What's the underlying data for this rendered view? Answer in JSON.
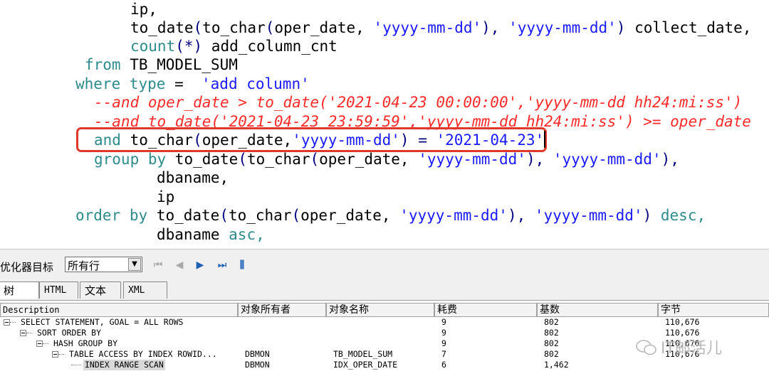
{
  "editor": {
    "lines": [
      [
        {
          "t": "ip,",
          "c": "tx"
        }
      ],
      [
        {
          "t": "to_date",
          "c": "tx"
        },
        {
          "t": "(",
          "c": "pn"
        },
        {
          "t": "to_char",
          "c": "tx"
        },
        {
          "t": "(",
          "c": "pn"
        },
        {
          "t": "oper_date, ",
          "c": "tx"
        },
        {
          "t": "'yyyy-mm-dd'",
          "c": "str"
        },
        {
          "t": "), ",
          "c": "pn"
        },
        {
          "t": "'yyyy-mm-dd'",
          "c": "str"
        },
        {
          "t": ") ",
          "c": "pn"
        },
        {
          "t": "collect_date,",
          "c": "tx"
        }
      ],
      [
        {
          "t": "count",
          "c": "kw"
        },
        {
          "t": "(*) ",
          "c": "pn"
        },
        {
          "t": "add_column_cnt",
          "c": "tx"
        }
      ],
      [
        {
          "t": "from ",
          "c": "kw"
        },
        {
          "t": "TB_MODEL_SUM",
          "c": "tx"
        }
      ],
      [
        {
          "t": "where ",
          "c": "kw"
        },
        {
          "t": "type",
          "c": "kw"
        },
        {
          "t": " =  ",
          "c": "tx"
        },
        {
          "t": "'add column'",
          "c": "str"
        }
      ],
      [
        {
          "t": "--and oper_date > to_date('2021-04-23 00:00:00','yyyy-mm-dd hh24:mi:ss')",
          "c": "cm"
        }
      ],
      [
        {
          "t": "--and to_date('2021-04-23 23:59:59','yyyy-mm-dd hh24:mi:ss') >= oper_date",
          "c": "cm"
        }
      ],
      [
        {
          "t": "and ",
          "c": "kw"
        },
        {
          "t": "to_char",
          "c": "tx"
        },
        {
          "t": "(",
          "c": "pn"
        },
        {
          "t": "oper_date,",
          "c": "tx"
        },
        {
          "t": "'yyyy-mm-dd'",
          "c": "str"
        },
        {
          "t": ") = ",
          "c": "pn"
        },
        {
          "t": "'2021-04-23'",
          "c": "str"
        }
      ],
      [
        {
          "t": "group by ",
          "c": "kw"
        },
        {
          "t": "to_date",
          "c": "tx"
        },
        {
          "t": "(",
          "c": "pn"
        },
        {
          "t": "to_char",
          "c": "tx"
        },
        {
          "t": "(",
          "c": "pn"
        },
        {
          "t": "oper_date, ",
          "c": "tx"
        },
        {
          "t": "'yyyy-mm-dd'",
          "c": "str"
        },
        {
          "t": "), ",
          "c": "pn"
        },
        {
          "t": "'yyyy-mm-dd'",
          "c": "str"
        },
        {
          "t": "),",
          "c": "pn"
        }
      ],
      [
        {
          "t": "dbaname,",
          "c": "tx"
        }
      ],
      [
        {
          "t": "ip",
          "c": "tx"
        }
      ],
      [
        {
          "t": "order by ",
          "c": "kw"
        },
        {
          "t": "to_date",
          "c": "tx"
        },
        {
          "t": "(",
          "c": "pn"
        },
        {
          "t": "to_char",
          "c": "tx"
        },
        {
          "t": "(",
          "c": "pn"
        },
        {
          "t": "oper_date, ",
          "c": "tx"
        },
        {
          "t": "'yyyy-mm-dd'",
          "c": "str"
        },
        {
          "t": "), ",
          "c": "pn"
        },
        {
          "t": "'yyyy-mm-dd'",
          "c": "str"
        },
        {
          "t": ") ",
          "c": "pn"
        },
        {
          "t": "desc,",
          "c": "kw"
        }
      ],
      [
        {
          "t": "dbaname ",
          "c": "tx"
        },
        {
          "t": "asc,",
          "c": "kw"
        }
      ]
    ]
  },
  "toolbar": {
    "optimizer_label": "优化器目标",
    "optimizer_value": "所有行"
  },
  "tabs": {
    "tree": "树",
    "html": "HTML",
    "text": "文本",
    "xml": "XML"
  },
  "plan": {
    "headers": [
      "Description",
      "对象所有者",
      "对象名称",
      "耗费",
      "基数",
      "字节"
    ],
    "rows": [
      {
        "description": "SELECT STATEMENT, GOAL = ALL ROWS",
        "owner": "",
        "name": "",
        "cost": "9",
        "cardinality": "802",
        "bytes": "110,676"
      },
      {
        "description": "SORT ORDER BY",
        "owner": "",
        "name": "",
        "cost": "9",
        "cardinality": "802",
        "bytes": "110,676"
      },
      {
        "description": "HASH GROUP BY",
        "owner": "",
        "name": "",
        "cost": "9",
        "cardinality": "802",
        "bytes": "110,676"
      },
      {
        "description": "TABLE ACCESS BY INDEX ROWID...",
        "owner": "DBMON",
        "name": "TB_MODEL_SUM",
        "cost": "7",
        "cardinality": "802",
        "bytes": "110,676"
      },
      {
        "description": "INDEX RANGE SCAN",
        "owner": "DBMON",
        "name": "IDX_OPER_DATE",
        "cost": "6",
        "cardinality": "1,462",
        "bytes": ""
      }
    ]
  },
  "watermark": "IT邮活儿"
}
